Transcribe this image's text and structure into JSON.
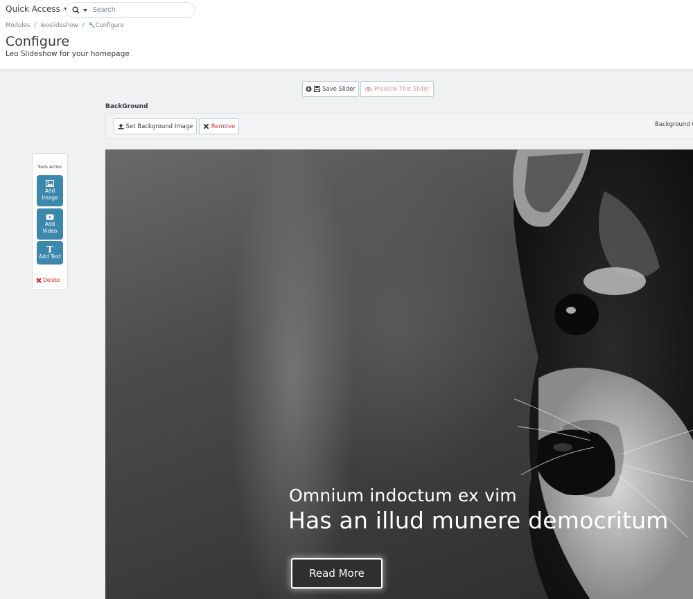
{
  "header": {
    "quick_access": "Quick Access",
    "search": {
      "placeholder": "Search"
    },
    "breadcrumb": [
      "Modules",
      "leoslideshow",
      "Configure"
    ],
    "title": "Configure",
    "subtitle": "Leo Slideshow for your homepage"
  },
  "toolbar": {
    "save_label": "Save Slider",
    "preview_label": "Preview This Slider"
  },
  "background": {
    "label": "BackGround",
    "set_label": "Set Background Image",
    "remove_label": "Remove",
    "right_label": "Background C"
  },
  "tools": {
    "title": "Tools Action",
    "add_image_line1": "Add",
    "add_image_line2": "Image",
    "add_video_line1": "Add",
    "add_video_line2": "Video",
    "add_text": "Add Text",
    "delete": "Delete"
  },
  "slide": {
    "caption_small": "Omnium indoctum ex vim",
    "caption_large": "Has an illud munere democritum",
    "button": "Read More"
  },
  "colors": {
    "accent": "#3c87ac",
    "danger": "#e02a2a",
    "preview": "#e08f95"
  }
}
